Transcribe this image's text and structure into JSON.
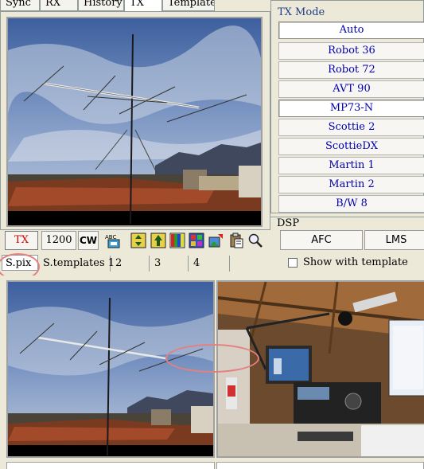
{
  "top_tabs": [
    {
      "label": "Sync"
    },
    {
      "label": "RX"
    },
    {
      "label": "History"
    },
    {
      "label": "TX",
      "active": true
    },
    {
      "label": "Template"
    }
  ],
  "toolbar": {
    "tx_label": "TX",
    "baud_label": "1200",
    "cw_label": "CW",
    "icons": [
      "abc-text-icon",
      "gradient-up-down-icon",
      "arrow-up-icon",
      "color-bars-icon",
      "color-grid-icon",
      "image-edit-icon",
      "clipboard-paste-icon",
      "magnifier-icon"
    ]
  },
  "picture_tabs": [
    {
      "label": "S.pix",
      "active": true
    },
    {
      "label": "S.templates 1"
    },
    {
      "label": "2"
    },
    {
      "label": "3"
    },
    {
      "label": "4"
    }
  ],
  "tx_mode": {
    "title": "TX Mode",
    "modes": [
      {
        "label": "Auto",
        "pressed": true
      },
      {
        "label": "Robot 36"
      },
      {
        "label": "Robot 72"
      },
      {
        "label": "AVT 90"
      },
      {
        "label": "MP73-N",
        "pressed": true
      },
      {
        "label": "Scottie 2"
      },
      {
        "label": "ScottieDX"
      },
      {
        "label": "Martin 1"
      },
      {
        "label": "Martin 2"
      },
      {
        "label": "B/W 8"
      }
    ]
  },
  "dsp": {
    "title": "DSP",
    "afc_label": "AFC",
    "lms_label": "LMS"
  },
  "show_with_template": {
    "label": "Show with template",
    "checked": false
  },
  "colors": {
    "accent_blue": "#0000b0",
    "group_title": "#1f3d8a",
    "tx_red": "#d40000",
    "annotation": "#e38080",
    "panel_bg": "#ece9d8"
  }
}
